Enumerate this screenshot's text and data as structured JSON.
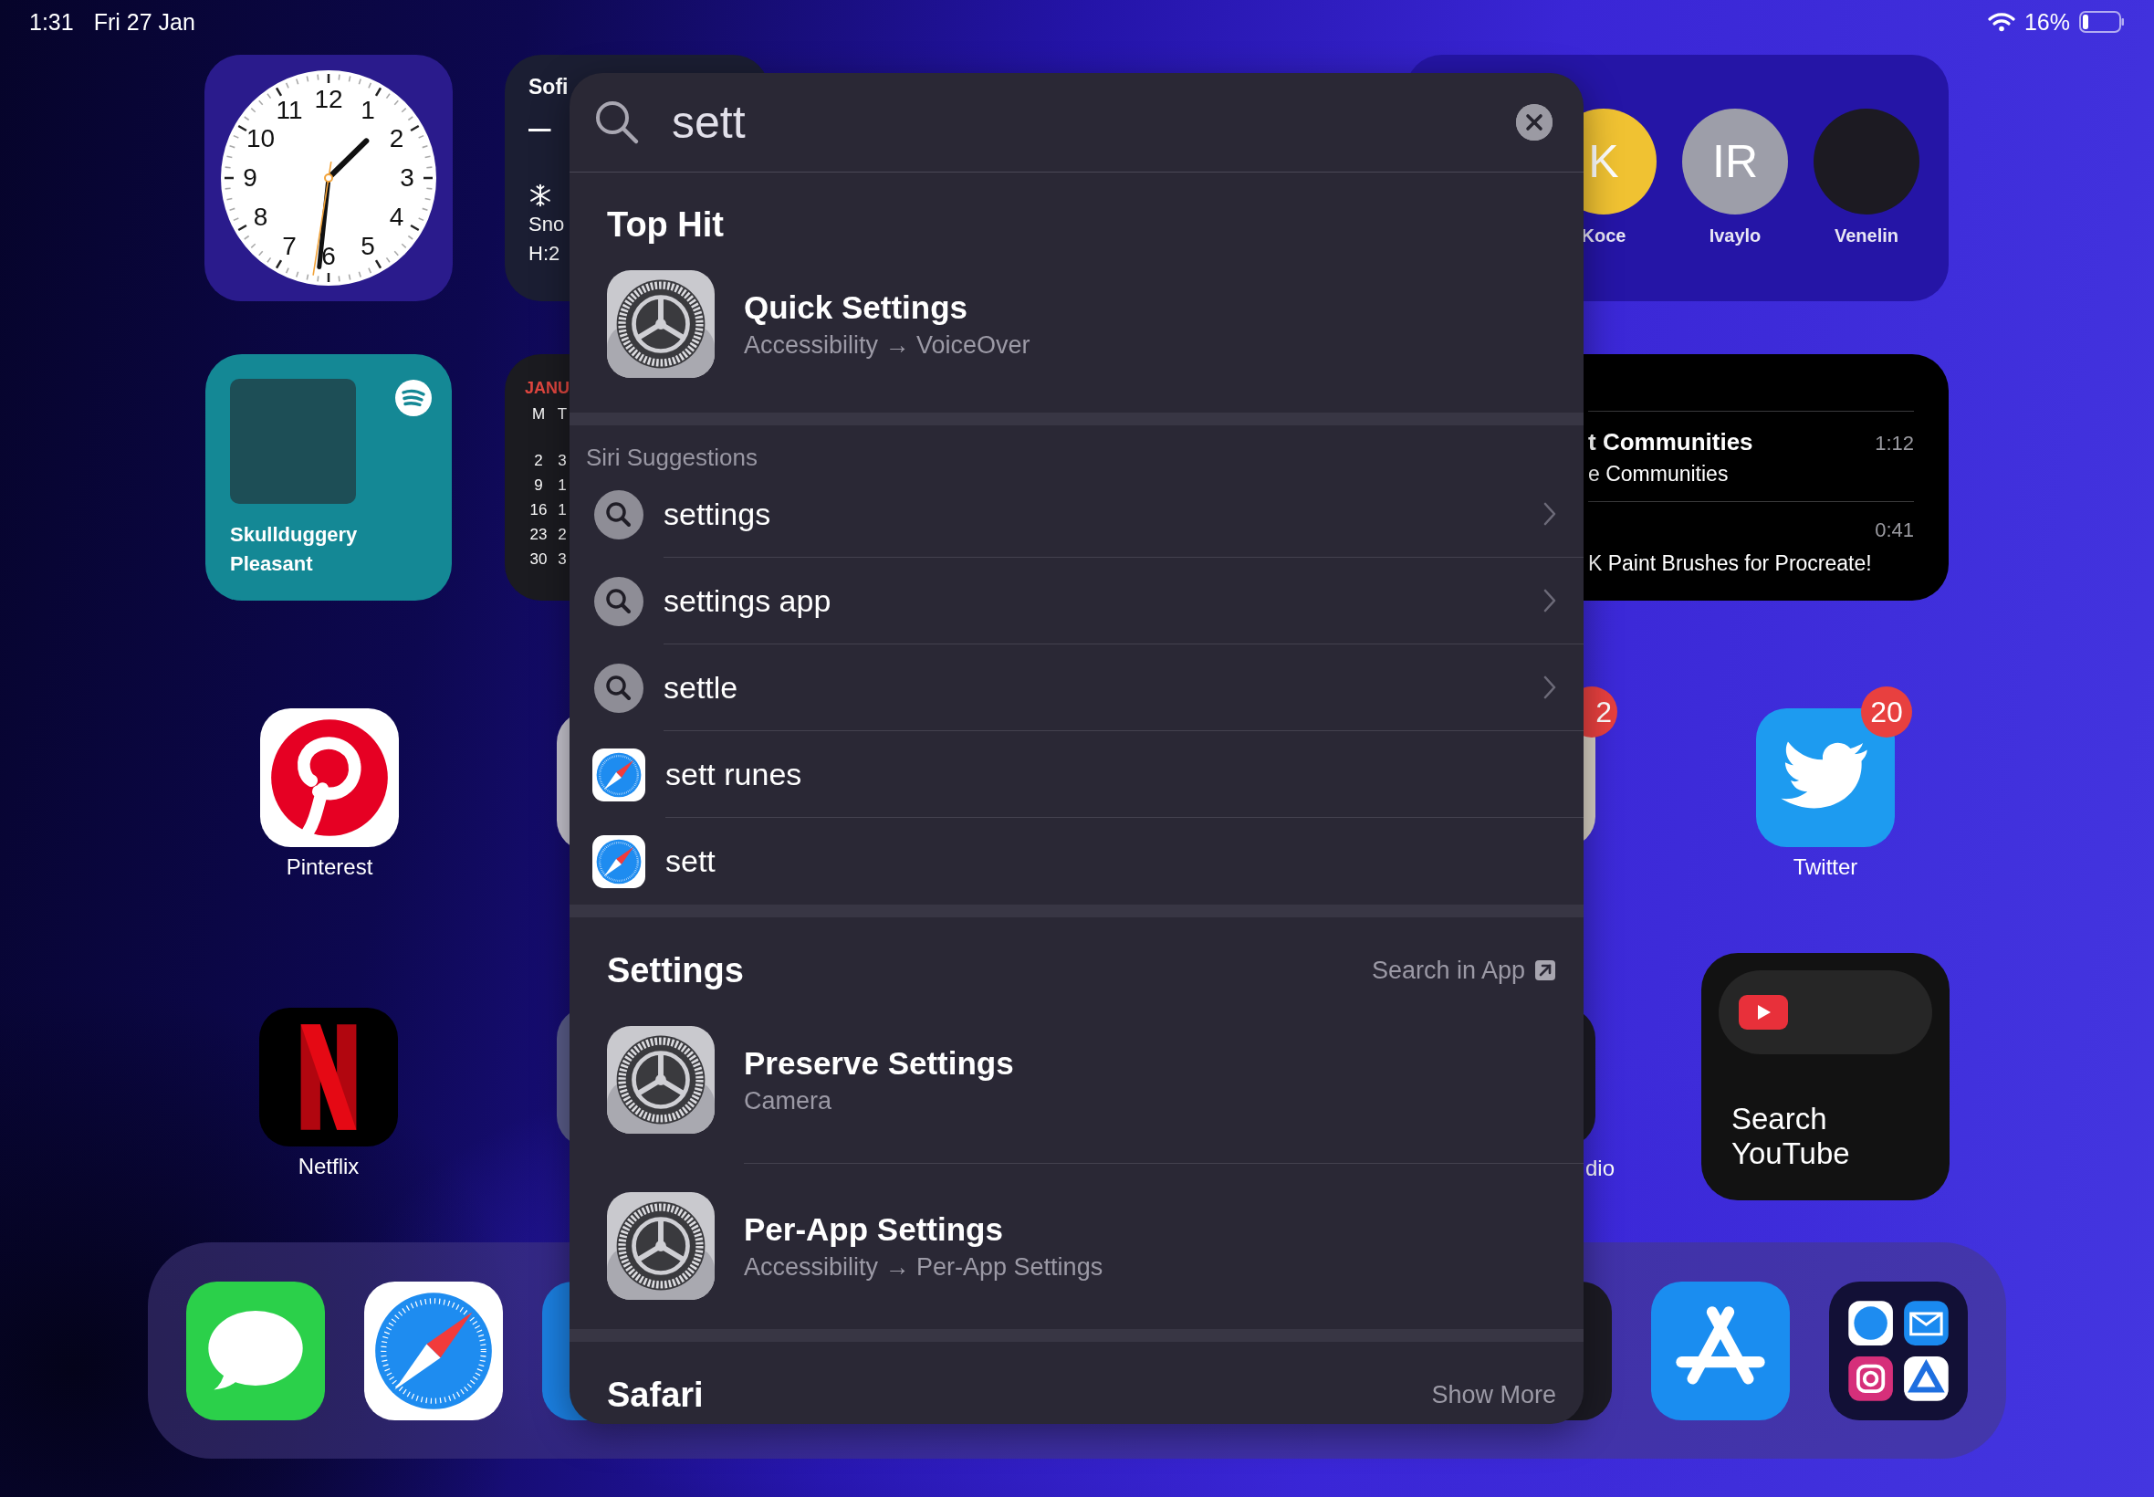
{
  "status_bar": {
    "time": "1:31",
    "date": "Fri 27 Jan",
    "battery": "16%"
  },
  "clock_widget": {
    "numerals": [
      "11",
      "12",
      "1",
      "10",
      "2",
      "9",
      "3",
      "8",
      "4",
      "7",
      "6",
      "5"
    ]
  },
  "weather_widget": {
    "city": "Sofi",
    "temperature": "–",
    "condition": "Sno",
    "high_low": "H:2"
  },
  "music_widget": {
    "title": "Skullduggery Pleasant"
  },
  "calendar_widget": {
    "month": "JANU",
    "weekdays": [
      "M",
      "T"
    ],
    "weeks": [
      [
        "2",
        "3"
      ],
      [
        "9",
        "1"
      ],
      [
        "16",
        "1"
      ],
      [
        "23",
        "2"
      ],
      [
        "30",
        "3"
      ]
    ]
  },
  "people_widget": {
    "people": [
      {
        "name": "Koce",
        "kind": "initials",
        "initials": "K",
        "color": "#f0c232"
      },
      {
        "name": "Ivaylo",
        "kind": "initials",
        "initials": "IR",
        "color": "#9d9ea9"
      },
      {
        "name": "Venelin",
        "kind": "photo"
      }
    ]
  },
  "podcast_widget": {
    "episodes": [
      {
        "title": "t Communities",
        "subtitle": "e Communities",
        "duration": "1:12"
      },
      {
        "subtitle": "K Paint Brushes for Procreate!",
        "duration": "0:41"
      }
    ]
  },
  "apps": [
    {
      "name": "Pinterest",
      "kind": "pinterest"
    },
    {
      "name": "Netflix",
      "kind": "netflix"
    },
    {
      "name": "Twitter",
      "kind": "twitter",
      "badge": "20"
    }
  ],
  "covered_apps": [
    {
      "kind": "grey"
    },
    {
      "kind": "slate"
    },
    {
      "kind": "beige",
      "badge": "2"
    },
    {
      "kind": "dark",
      "label": "dio"
    }
  ],
  "youtube_widget": {
    "label": "Search YouTube"
  },
  "dock": {
    "apps": [
      {
        "kind": "messages"
      },
      {
        "kind": "safari"
      },
      {
        "kind": "covered_blue"
      },
      {
        "kind": "covered_dark"
      },
      {
        "kind": "app_store"
      },
      {
        "kind": "folder"
      }
    ]
  },
  "spotlight": {
    "query": "sett",
    "sections": [
      {
        "kind": "top_hit",
        "title": "Top Hit",
        "results": [
          {
            "kind": "settings",
            "title": "Quick Settings",
            "subtitle": "Accessibility → VoiceOver"
          }
        ]
      },
      {
        "kind": "suggestions",
        "title": "Siri Suggestions",
        "results": [
          {
            "kind": "search",
            "text": "settings",
            "chevron": true
          },
          {
            "kind": "search",
            "text": "settings app",
            "chevron": true
          },
          {
            "kind": "search",
            "text": "settle",
            "chevron": true
          },
          {
            "kind": "web",
            "text": "sett runes",
            "chevron": false
          },
          {
            "kind": "web",
            "text": "sett",
            "chevron": false
          }
        ]
      },
      {
        "kind": "app",
        "title": "Settings",
        "action": "Search in App",
        "action_icon": true,
        "results": [
          {
            "kind": "settings",
            "title": "Preserve Settings",
            "subtitle": "Camera"
          },
          {
            "kind": "settings",
            "title": "Per-App Settings",
            "subtitle": "Accessibility → Per-App Settings"
          }
        ]
      },
      {
        "kind": "app",
        "title": "Safari",
        "action": "Show More",
        "action_icon": false
      }
    ]
  }
}
